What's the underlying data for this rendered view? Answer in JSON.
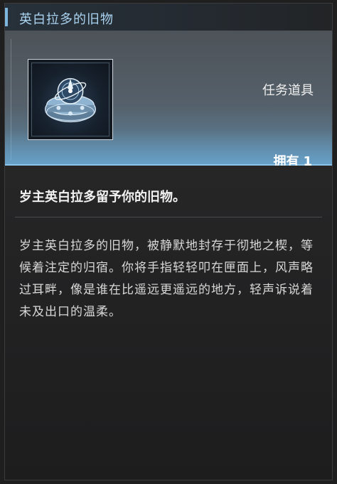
{
  "item": {
    "title": "英白拉多的旧物",
    "type": "任务道具",
    "owned_label": "拥有",
    "owned_count": "1",
    "icon": "ornate-orb-relic-icon",
    "summary": "岁主英白拉多留予你的旧物。",
    "description": "岁主英白拉多的旧物，被静默地封存于彻地之楔，等候着注定的归宿。你将手指轻轻叩在匣面上，风声略过耳畔，像是谁在比遥远更遥远的地方，轻声诉说着未及出口的温柔。"
  },
  "colors": {
    "title_accent": "#7db6de",
    "header_glow": "#6eb4e6",
    "panel_bg": "#232324"
  }
}
